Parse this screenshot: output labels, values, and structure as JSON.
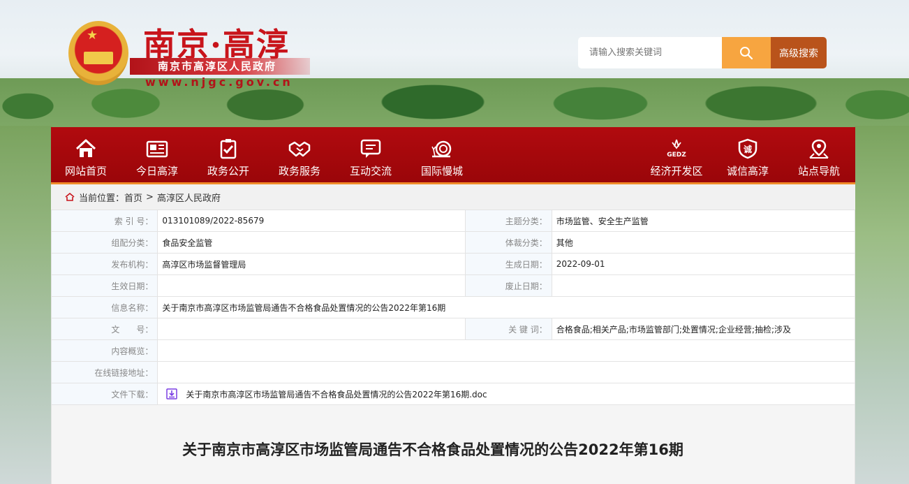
{
  "header": {
    "title": "南京·高淳",
    "subtitle": "南京市高淳区人民政府",
    "domain": "www.njgc.gov.cn"
  },
  "search": {
    "placeholder": "请输入搜索关键词",
    "advanced_label": "高级搜索"
  },
  "nav": {
    "left": [
      {
        "label": "网站首页",
        "icon": "home-icon"
      },
      {
        "label": "今日高淳",
        "icon": "newspaper-icon"
      },
      {
        "label": "政务公开",
        "icon": "clipboard-check-icon"
      },
      {
        "label": "政务服务",
        "icon": "handshake-icon"
      },
      {
        "label": "互动交流",
        "icon": "chat-icon"
      },
      {
        "label": "国际慢城",
        "icon": "snail-icon"
      }
    ],
    "right": [
      {
        "label": "经济开发区",
        "icon": "gedz-logo-icon",
        "logo_text": "GEDZ"
      },
      {
        "label": "诚信高淳",
        "icon": "shield-icon",
        "logo_text": "诚"
      },
      {
        "label": "站点导航",
        "icon": "location-icon"
      }
    ]
  },
  "breadcrumb": {
    "prefix": "当前位置：",
    "items": [
      "首页",
      ">",
      "高淳区人民政府"
    ]
  },
  "info": {
    "index_label": "索 引 号：",
    "index_value": "013101089/2022-85679",
    "topic_label": "主题分类：",
    "topic_value": "市场监管、安全生产监管",
    "group_label": "组配分类：",
    "group_value": "食品安全监管",
    "genre_label": "体裁分类：",
    "genre_value": "其他",
    "publisher_label": "发布机构：",
    "publisher_value": "高淳区市场监督管理局",
    "created_label": "生成日期：",
    "created_value": "2022-09-01",
    "effective_label": "生效日期：",
    "effective_value": "",
    "expired_label": "废止日期：",
    "expired_value": "",
    "name_label": "信息名称：",
    "name_value": "关于南京市高淳区市场监管局通告不合格食品处置情况的公告2022年第16期",
    "docno_label": "文　　号：",
    "docno_value": "",
    "keywords_label": "关 键 词：",
    "keywords_value": "合格食品;相关产品;市场监管部门;处置情况;企业经营;抽检;涉及",
    "summary_label": "内容概览：",
    "summary_value": "",
    "link_label": "在线链接地址：",
    "link_value": "",
    "download_label": "文件下载：",
    "download_value": "关于南京市高淳区市场监管局通告不合格食品处置情况的公告2022年第16期.doc"
  },
  "article": {
    "title": "关于南京市高淳区市场监管局通告不合格食品处置情况的公告2022年第16期"
  },
  "colors": {
    "nav_red": "#a50a0e",
    "accent_orange": "#f7a540",
    "adv_button": "#b9531b",
    "title_red": "#c8141b"
  }
}
